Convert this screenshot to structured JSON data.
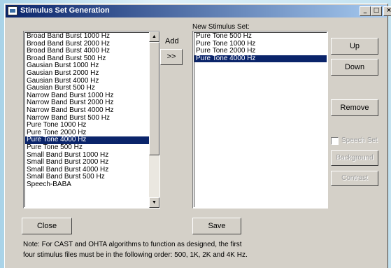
{
  "window": {
    "title": "Stimulus Set Generation",
    "controls": {
      "minimize": "_",
      "maximize": "□",
      "close": "×"
    }
  },
  "source_list": {
    "items": [
      "Broad Band Burst 1000 Hz",
      "Broad Band Burst 2000 Hz",
      "Broad Band Burst 4000 Hz",
      "Broad Band Burst 500 Hz",
      "Gausian Burst 1000 Hz",
      "Gausian Burst 2000 Hz",
      "Gausian Burst 4000 Hz",
      "Gausian Burst 500 Hz",
      "Narrow Band Burst 1000 Hz",
      "Narrow Band Burst 2000 Hz",
      "Narrow Band Burst 4000 Hz",
      "Narrow Band Burst 500 Hz",
      "Pure Tone 1000 Hz",
      "Pure Tone 2000 Hz",
      "Pure Tone 4000 Hz",
      "Pure Tone 500 Hz",
      "Small Band Burst 1000 Hz",
      "Small Band Burst 2000 Hz",
      "Small Band Burst 4000 Hz",
      "Small Band Burst 500 Hz",
      "Speech-BABA"
    ],
    "selected_index": 14
  },
  "add": {
    "label": "Add",
    "button_label": ">>"
  },
  "new_set": {
    "label": "New Stimulus Set:",
    "items": [
      "Pure Tone 500 Hz",
      "Pure Tone 1000 Hz",
      "Pure Tone 2000 Hz",
      "Pure Tone 4000 Hz"
    ],
    "selected_index": 3
  },
  "buttons": {
    "up": "Up",
    "down": "Down",
    "remove": "Remove",
    "background": "Background",
    "contrast": "Contrast",
    "close": "Close",
    "save": "Save"
  },
  "speech_set": {
    "label": "Speech Set",
    "checked": false,
    "enabled": false
  },
  "note": {
    "line1": "Note: For CAST and OHTA algorithms to function as designed, the first",
    "line2": "four stimulus files must be in the following order: 500, 1K, 2K and 4K Hz."
  },
  "colors": {
    "selection": "#0a246a",
    "titlebar_start": "#0a246a",
    "titlebar_end": "#a6caf0"
  }
}
